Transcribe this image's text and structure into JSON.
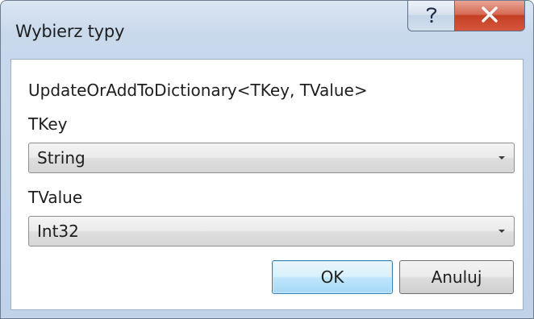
{
  "window": {
    "title": "Wybierz typy",
    "help_icon": "question-mark-icon",
    "close_icon": "close-x-icon"
  },
  "method_signature": "UpdateOrAddToDictionary<TKey, TValue>",
  "fields": [
    {
      "label": "TKey",
      "selected": "String"
    },
    {
      "label": "TValue",
      "selected": "Int32"
    }
  ],
  "buttons": {
    "ok_label": "OK",
    "cancel_label": "Anuluj"
  },
  "colors": {
    "close_button": "#c43f24",
    "ok_button_border": "#3c7fb1",
    "frame": "#bfd2e8"
  }
}
